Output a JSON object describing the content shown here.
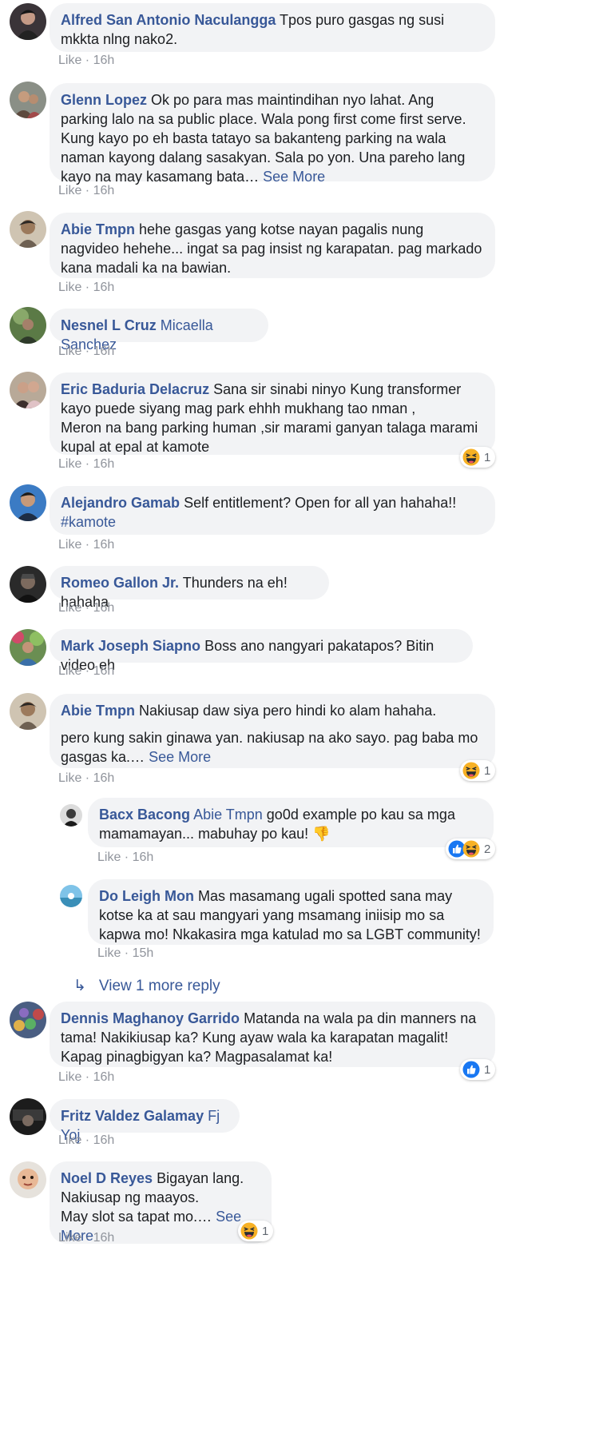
{
  "comments": [
    {
      "name": "Alfred San Antonio Naculangga",
      "text": "Tpos puro gasgas ng susi mkkta nlng nako2.",
      "like": "Like",
      "time": "16h"
    },
    {
      "name": "Glenn Lopez",
      "text": "Ok po para mas maintindihan nyo lahat. Ang parking lalo na sa public place. Wala pong first come first serve. Kung kayo po eh basta tatayo sa bakanteng parking na wala naman kayong dalang sasakyan. Sala po yon. Una pareho lang kayo na may kasamang bata…",
      "see_more": "See More",
      "like": "Like",
      "time": "16h"
    },
    {
      "name": "Abie Tmpn",
      "text": "hehe gasgas yang kotse nayan pagalis nung nagvideo hehehe... ingat sa pag insist ng karapatan. pag markado kana madali ka na bawian.",
      "like": "Like",
      "time": "16h"
    },
    {
      "name": "Nesnel L Cruz",
      "mention": "Micaella Sanchez",
      "like": "Like",
      "time": "16h"
    },
    {
      "name": "Eric Baduria Delacruz",
      "text": "Sana sir sinabi ninyo Kung transformer kayo puede siyang mag park ehhh mukhang tao nman ,",
      "text2": "Meron na bang parking human ,sir marami ganyan talaga marami kupal at epal at kamote",
      "like": "Like",
      "time": "16h",
      "reaction_count": "1"
    },
    {
      "name": "Alejandro Gamab",
      "text": "Self entitlement? Open for all yan hahaha!!",
      "hashtag": "#kamote",
      "like": "Like",
      "time": "16h"
    },
    {
      "name": "Romeo Gallon Jr.",
      "text": "Thunders na eh! hahaha",
      "like": "Like",
      "time": "16h"
    },
    {
      "name": "Mark Joseph Siapno",
      "text": "Boss ano nangyari pakatapos? Bitin video eh",
      "like": "Like",
      "time": "16h"
    },
    {
      "name": "Abie Tmpn",
      "text": "Nakiusap daw siya pero hindi ko alam hahaha.",
      "text2": "pero kung sakin ginawa yan. nakiusap na ako sayo. pag baba mo gasgas ka.…",
      "see_more": "See More",
      "like": "Like",
      "time": "16h",
      "reaction_count": "1"
    },
    {
      "name": "Dennis Maghanoy Garrido",
      "text": "Matanda na wala pa din manners na tama! Nakikiusap ka? Kung ayaw wala ka karapatan magalit! Kapag pinagbigyan ka? Magpasalamat ka!",
      "like": "Like",
      "time": "16h",
      "reaction_count": "1"
    },
    {
      "name": "Fritz Valdez Galamay",
      "mention": "Fj Yoj",
      "like": "Like",
      "time": "16h"
    },
    {
      "name": "Noel D Reyes",
      "text": "Bigayan lang.",
      "text2": "Nakiusap ng maayos.",
      "text3": "May slot sa tapat mo.…",
      "see_more": "See More",
      "like": "Like",
      "time": "16h",
      "reaction_count": "1"
    }
  ],
  "replies": [
    {
      "name": "Bacx Bacong",
      "mention": "Abie Tmpn",
      "text": "go0d example po kau sa mga mamamayan... mabuhay po kau!",
      "emoji": "👎",
      "like": "Like",
      "time": "16h",
      "reaction_count": "2"
    },
    {
      "name": "Do Leigh Mon",
      "text": "Mas masamang ugali spotted sana may kotse ka at sau mangyari yang msamang iniisip mo sa kapwa mo! Nkakasira mga katulad mo sa LGBT community!",
      "like": "Like",
      "time": "15h"
    }
  ],
  "view_more_replies": "View 1 more reply",
  "separator": " · ",
  "colors": {
    "link": "#385898",
    "bubble": "#f2f3f5",
    "meta": "#90949c",
    "haha": "#f7b125",
    "like_blue": "#1877f2"
  }
}
